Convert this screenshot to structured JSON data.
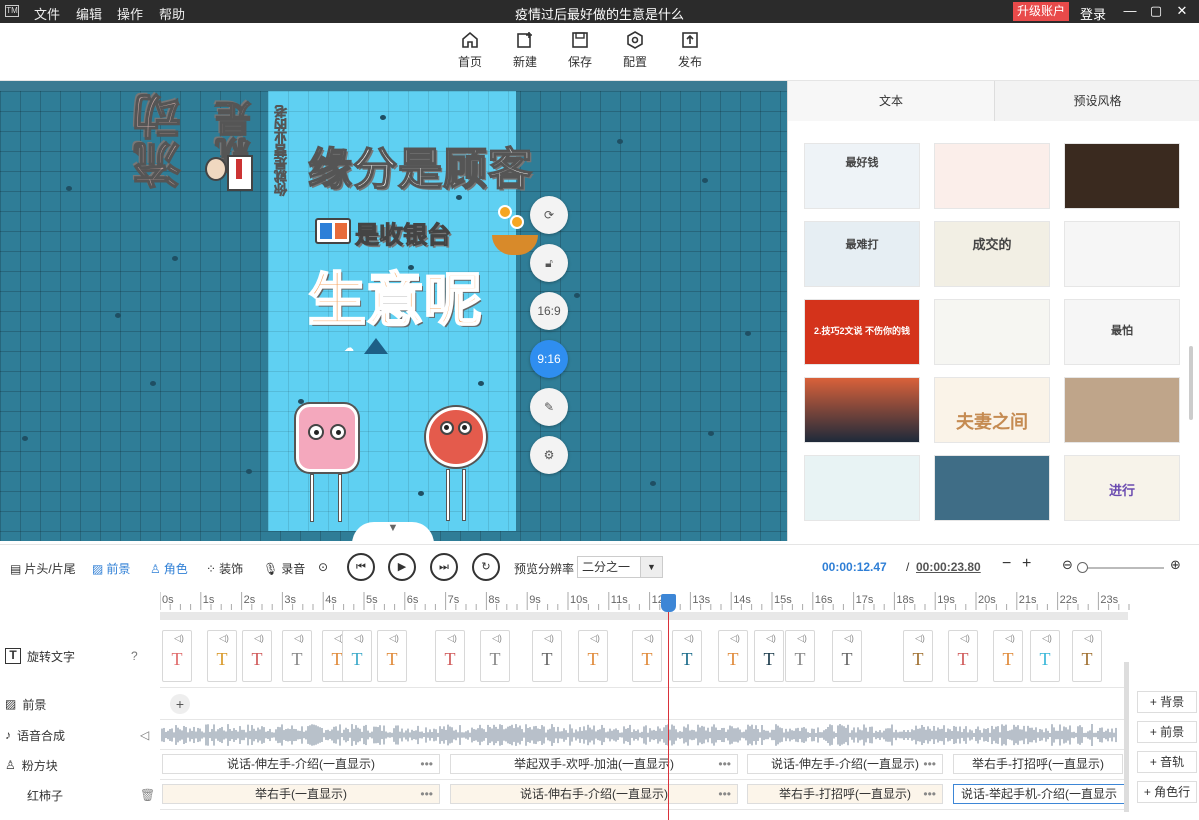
{
  "titlebar": {
    "logo": "TM",
    "menus": [
      "文件",
      "编辑",
      "操作",
      "帮助"
    ],
    "title": "疫情过后最好做的生意是什么",
    "upgrade": "升级账户",
    "login": "登录"
  },
  "toolbar": {
    "items": [
      {
        "label": "首页",
        "icon": "home-icon"
      },
      {
        "label": "新建",
        "icon": "new-icon"
      },
      {
        "label": "保存",
        "icon": "save-icon"
      },
      {
        "label": "配置",
        "icon": "settings-icon"
      },
      {
        "label": "发布",
        "icon": "publish-icon"
      }
    ]
  },
  "canvas": {
    "main_text": "缘分是顾客",
    "text2": "是收银台",
    "text3": "生意呢",
    "side_text": "流动",
    "side_text2": "就是",
    "vertical_text": "你就是营业的老",
    "controls": [
      "16:9",
      "9:16"
    ]
  },
  "right_panel": {
    "tabs": [
      "文本",
      "预设风格"
    ],
    "thumbs": [
      "最好钱",
      "",
      "",
      "最难打",
      "成交的",
      "",
      "2.技巧2文说 不伤你的钱",
      "",
      "最怕",
      "",
      "夫妻之间",
      "",
      "",
      "",
      "进行"
    ]
  },
  "controlbar": {
    "head_tail": "片头/片尾",
    "foreground": "前景",
    "role": "角色",
    "decor": "装饰",
    "record": "录音",
    "resolution_label": "预览分辨率",
    "resolution_value": "二分之一",
    "current_time": "00:00:12.47",
    "separator": "/",
    "total_time": "00:00:23.80"
  },
  "ruler": {
    "ticks": [
      "0s",
      "1s",
      "2s",
      "3s",
      "4s",
      "5s",
      "6s",
      "7s",
      "8s",
      "9s",
      "10s",
      "11s",
      "12s",
      "13s",
      "14s",
      "15s",
      "16s",
      "17s",
      "18s",
      "19s",
      "20s",
      "21s",
      "22s",
      "23s",
      "24s"
    ]
  },
  "tracks": {
    "rotating_text": "旋转文字",
    "foreground": "前景",
    "tts": "语音合成",
    "role1": "粉方块",
    "role2": "红柿子"
  },
  "role1_actions": [
    "说话-伸左手-介绍(一直显示)",
    "举起双手-欢呼-加油(一直显示)",
    "说话-伸左手-介绍(一直显示)",
    "举右手-打招呼(一直显示)"
  ],
  "role2_actions": [
    "举右手(一直显示)",
    "说话-伸右手-介绍(一直显示)",
    "举右手-打招呼(一直显示)",
    "说话-举起手机-介绍(一直显示"
  ],
  "add_buttons": [
    "背景",
    "前景",
    "音轨",
    "角色行"
  ],
  "text_card_T": "T",
  "colors": {
    "accent": "#2f8ef0",
    "playhead": "#d9323a",
    "upgrade": "#e84a4a"
  }
}
